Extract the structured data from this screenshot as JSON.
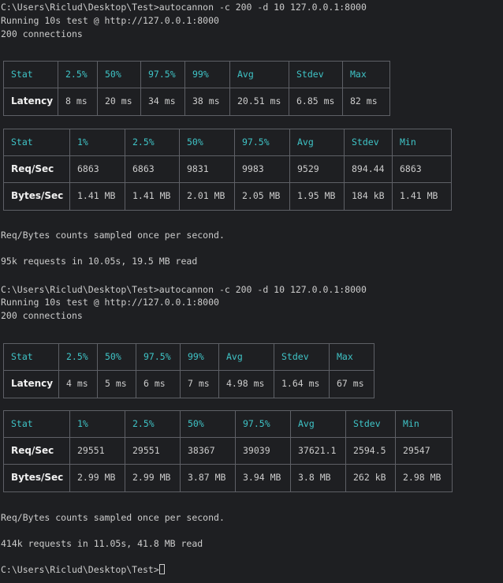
{
  "runs": [
    {
      "command": "C:\\Users\\Riclud\\Desktop\\Test>autocannon -c 200 -d 10 127.0.0.1:8000",
      "running": "Running 10s test @ http://127.0.0.1:8000",
      "connections": "200 connections",
      "latency_table": {
        "header": [
          "Stat",
          "2.5%",
          "50%",
          "97.5%",
          "99%",
          "Avg",
          "Stdev",
          "Max"
        ],
        "rows": [
          [
            "Latency",
            "8 ms",
            "20 ms",
            "34 ms",
            "38 ms",
            "20.51 ms",
            "6.85 ms",
            "82 ms"
          ]
        ]
      },
      "throughput_table": {
        "header": [
          "Stat",
          "1%",
          "2.5%",
          "50%",
          "97.5%",
          "Avg",
          "Stdev",
          "Min"
        ],
        "rows": [
          [
            "Req/Sec",
            "6863",
            "6863",
            "9831",
            "9983",
            "9529",
            "894.44",
            "6863"
          ],
          [
            "Bytes/Sec",
            "1.41 MB",
            "1.41 MB",
            "2.01 MB",
            "2.05 MB",
            "1.95 MB",
            "184 kB",
            "1.41 MB"
          ]
        ]
      },
      "sampled_note": "Req/Bytes counts sampled once per second.",
      "summary": "95k requests in 10.05s, 19.5 MB read"
    },
    {
      "command": "C:\\Users\\Riclud\\Desktop\\Test>autocannon -c 200 -d 10 127.0.0.1:8000",
      "running": "Running 10s test @ http://127.0.0.1:8000",
      "connections": "200 connections",
      "latency_table": {
        "header": [
          "Stat",
          "2.5%",
          "50%",
          "97.5%",
          "99%",
          "Avg",
          "Stdev",
          "Max"
        ],
        "rows": [
          [
            "Latency",
            "4 ms",
            "5 ms",
            "6 ms",
            "7 ms",
            "4.98 ms",
            "1.64 ms",
            "67 ms"
          ]
        ]
      },
      "throughput_table": {
        "header": [
          "Stat",
          "1%",
          "2.5%",
          "50%",
          "97.5%",
          "Avg",
          "Stdev",
          "Min"
        ],
        "rows": [
          [
            "Req/Sec",
            "29551",
            "29551",
            "38367",
            "39039",
            "37621.1",
            "2594.5",
            "29547"
          ],
          [
            "Bytes/Sec",
            "2.99 MB",
            "2.99 MB",
            "3.87 MB",
            "3.94 MB",
            "3.8 MB",
            "262 kB",
            "2.98 MB"
          ]
        ]
      },
      "sampled_note": "Req/Bytes counts sampled once per second.",
      "summary": "414k requests in 11.05s, 41.8 MB read"
    }
  ],
  "prompt": "C:\\Users\\Riclud\\Desktop\\Test>",
  "colors": {
    "background": "#1e1f22",
    "text": "#cccccc",
    "header": "#3fc4c7",
    "border": "#5e6066"
  }
}
